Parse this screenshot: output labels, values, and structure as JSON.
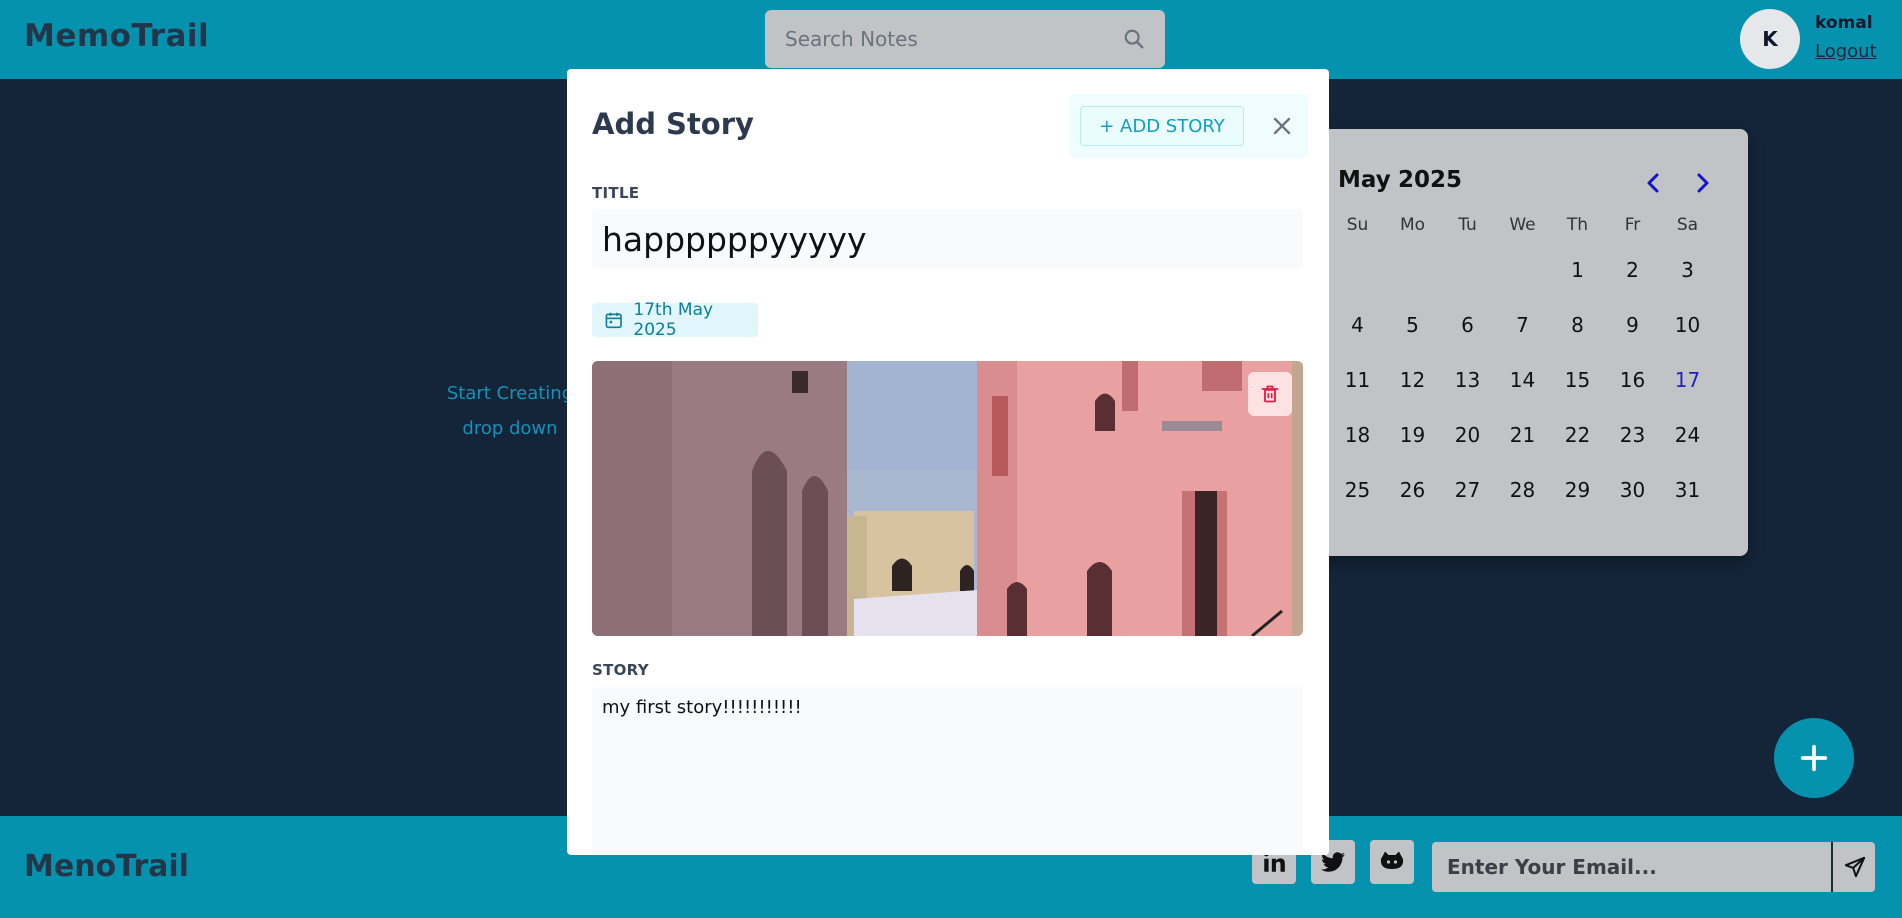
{
  "header": {
    "logo": "MemoTrail",
    "search_placeholder": "Search Notes",
    "avatar_initial": "K",
    "username": "komal",
    "logout": "Logout"
  },
  "background": {
    "hint_line1": "Start Creating",
    "hint_line2": "drop down"
  },
  "calendar": {
    "month": "May",
    "year": "2025",
    "weekdays": [
      "Su",
      "Mo",
      "Tu",
      "We",
      "Th",
      "Fr",
      "Sa"
    ],
    "days": [
      "1",
      "2",
      "3",
      "4",
      "5",
      "6",
      "7",
      "8",
      "9",
      "10",
      "11",
      "12",
      "13",
      "14",
      "15",
      "16",
      "17",
      "18",
      "19",
      "20",
      "21",
      "22",
      "23",
      "24",
      "25",
      "26",
      "27",
      "28",
      "29",
      "30",
      "31"
    ],
    "selected_day": "17",
    "first_weekday_index": 4
  },
  "modal": {
    "title": "Add Story",
    "add_button": "+ ADD STORY",
    "title_label": "TITLE",
    "title_value": "happppppyyyyy",
    "date": "17th May 2025",
    "story_label": "STORY",
    "story_value": "my first story!!!!!!!!!!!"
  },
  "footer": {
    "logo": "MenoTrail",
    "email_placeholder": "Enter Your Email..."
  },
  "colors": {
    "primary": "#0592ae",
    "background": "#14253a",
    "danger": "#e11d48"
  }
}
